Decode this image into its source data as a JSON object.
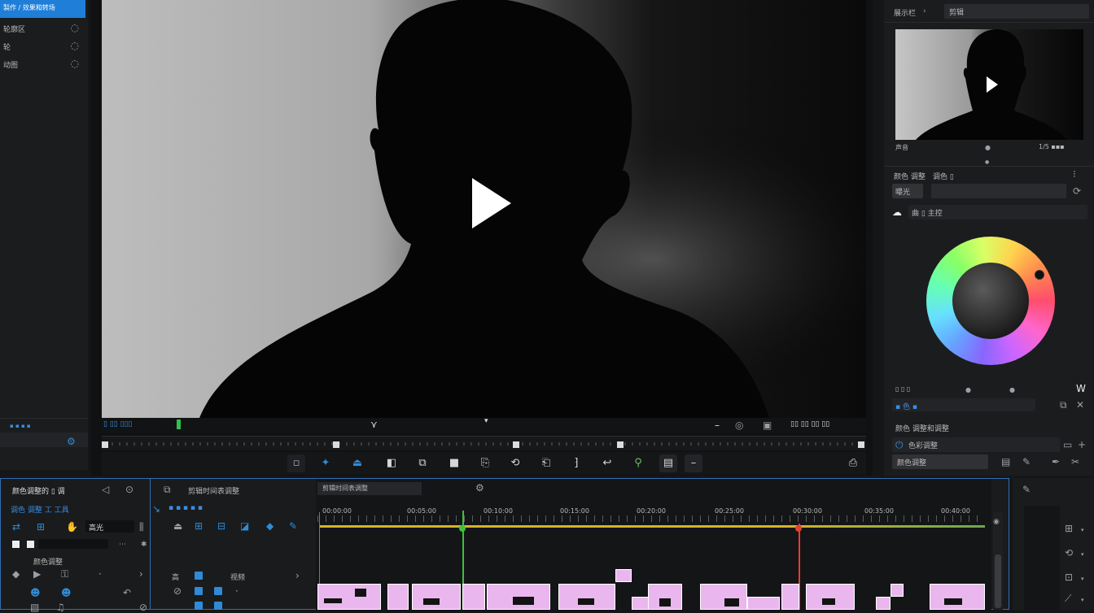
{
  "left_panel": {
    "items": [
      {
        "label": "製作 / 效果和转场",
        "selected": true
      },
      {
        "label": "轮廓区",
        "icon": "record-icon"
      },
      {
        "label": "轮",
        "icon": "record-icon"
      },
      {
        "label": "动图",
        "icon": "record-icon"
      }
    ],
    "footer_label": "▪ ▪ ▪ ▪"
  },
  "viewer": {
    "timecode_left": "▯ ▯▯ ▯▯▯",
    "timecode_right": "▯▯ ▯▯ ▯▯ ▯▯",
    "transport": [
      "snap-icon",
      "marker-icon",
      "trim-icon",
      "split-icon",
      "stop-icon",
      "step-back-icon",
      "loop-icon",
      "step-fwd-icon",
      "bracket-icon",
      "undo-icon",
      "magnet-icon",
      "box-icon",
      "minus-icon",
      "export-icon"
    ]
  },
  "right_panel": {
    "header_label": "展示栏",
    "header_value": "剪辑",
    "preview_caption": "声音",
    "preview_counter": "1/5 ▪▪▪",
    "section_title": "颜色 调整",
    "section_sub": "调色 ▯",
    "field_label": "曝光",
    "mode_label": "曲 ▯ 主控",
    "wheel_caption": "▯ ▯ ▯",
    "sub_section": "▪ 色 ▪",
    "list_title": "颜色 调整和调整",
    "list_item": "色彩调整",
    "list_value": "颜色调整"
  },
  "timeline": {
    "panel_title": "颜色调整的 ▯ 调",
    "track_header_title": "颜色调整",
    "controls_label": "调色 调整 工 工具",
    "sequence_name": "剪辑时间表调整",
    "track_name": "高光",
    "track_label_1": "高",
    "track_label_2": "视频",
    "time_marks": [
      "00:00:00",
      "00:05:00",
      "00:10:00",
      "00:15:00",
      "00:20:00",
      "00:25:00",
      "00:30:00",
      "00:35:00",
      "00:40:00"
    ]
  },
  "colors": {
    "accent": "#2f8bd6",
    "clip_fill": "#e9b7ee",
    "playhead_green": "#3ec23e",
    "playhead_red": "#e04030",
    "work_area": "#d4b428"
  }
}
